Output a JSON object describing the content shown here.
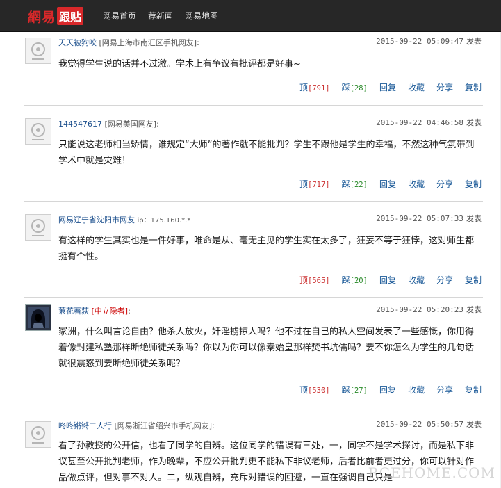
{
  "header": {
    "logo_part1": "網易",
    "logo_part2": "跟贴",
    "nav": [
      "网易首页",
      "荐新闻",
      "网易地图"
    ]
  },
  "posts": [
    {
      "user": "天天被狗咬",
      "location": "[网易上海市南汇区手机网友]",
      "ip": "",
      "colon": ":",
      "time": "2015-09-22 05:09:47",
      "publish": "发表",
      "text": "我觉得学生说的话并不过激。学术上有争议有批评都是好事~",
      "up_label": "顶",
      "up_count": "[791]",
      "down_label": "踩",
      "down_count": "[28]",
      "reply": "回复",
      "fav": "收藏",
      "share": "分享",
      "copy": "复制"
    },
    {
      "user": "144547617",
      "location": "[网易美国网友]",
      "ip": "",
      "colon": ":",
      "time": "2015-09-22 04:46:58",
      "publish": "发表",
      "text": "只能说这老师相当矫情，谁规定“大师”的著作就不能批判？学生不跟他是学生的幸福，不然这种气氛带到学术中就是灾难！",
      "up_label": "顶",
      "up_count": "[717]",
      "down_label": "踩",
      "down_count": "[22]",
      "reply": "回复",
      "fav": "收藏",
      "share": "分享",
      "copy": "复制"
    },
    {
      "user": "网易辽宁省沈阳市网友",
      "location": "",
      "ip": "ip：175.160.*.*",
      "colon": "",
      "time": "2015-09-22 05:07:33",
      "publish": "发表",
      "text": "有这样的学生其实也是一件好事，唯命是从、毫无主见的学生实在太多了，狂妄不等于狂悖，这对师生都挺有个性。",
      "up_label": "顶",
      "up_count": "[565]",
      "down_label": "踩",
      "down_count": "[20]",
      "reply": "回复",
      "fav": "收藏",
      "share": "分享",
      "copy": "复制"
    },
    {
      "user": "蒹花著荻",
      "location": "[中立隐者]",
      "ip": "",
      "colon": ":",
      "time": "2015-09-22 05:20:23",
      "publish": "发表",
      "text": "冢洲，什么叫言论自由？他杀人放火，奸淫掳掠人吗？他不过在自己的私人空间发表了一些感慨，你用得着像封建私塾那样断绝师徒关系吗？你以为你可以像秦始皇那样焚书坑儒吗？要不你怎么为学生的几句话就很震怒到要断绝师徒关系呢？",
      "up_label": "顶",
      "up_count": "[530]",
      "down_label": "踩",
      "down_count": "[27]",
      "reply": "回复",
      "fav": "收藏",
      "share": "分享",
      "copy": "复制"
    },
    {
      "user": "咚咚锵锵二人行",
      "location": "[网易浙江省绍兴市手机网友]",
      "ip": "",
      "colon": ":",
      "time": "2015-09-22 05:50:57",
      "publish": "发表",
      "text": "看了孙教授的公开信，也看了同学的自辨。这位同学的错误有三处，一，同学不是学术探讨，而是私下非议甚至公开批判老师，作为晚辈，不应公开批判更不能私下非议老师，后者比前者更过分，你可以针对作品做点评，但对事不对人。二，纵观自辨，充斥对错误的回避，一直在强调自己只是"
    }
  ],
  "watermark": "RCEHOME.COM"
}
